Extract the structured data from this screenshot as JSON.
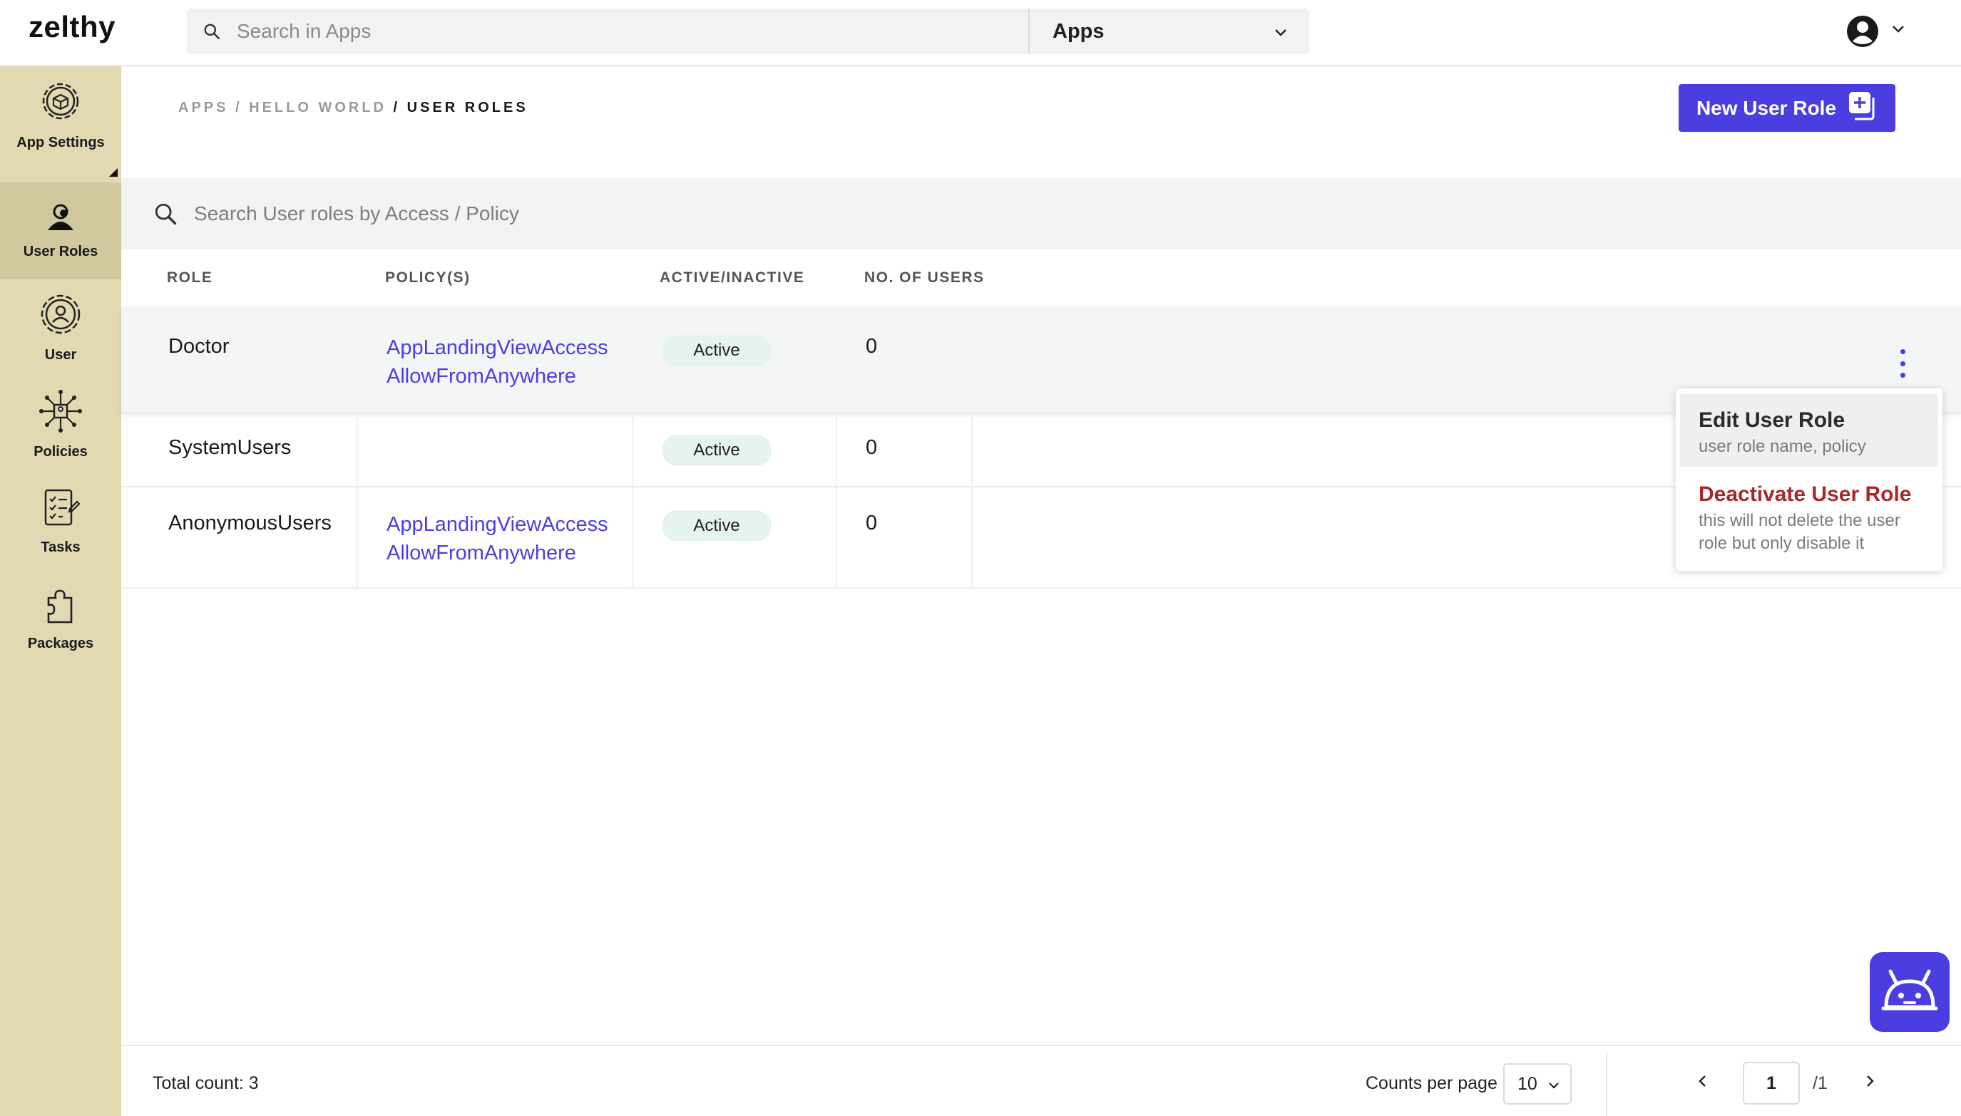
{
  "app": {
    "logo": "zelthy"
  },
  "topbar": {
    "search_placeholder": "Search in Apps",
    "scope_select": "Apps"
  },
  "sidebar": {
    "items": [
      {
        "label": "App Settings",
        "icon": "gear-box-icon"
      },
      {
        "label": "User Roles",
        "icon": "user-role-icon",
        "active": true
      },
      {
        "label": "User",
        "icon": "user-gear-icon"
      },
      {
        "label": "Policies",
        "icon": "policy-network-icon"
      },
      {
        "label": "Tasks",
        "icon": "task-list-icon"
      },
      {
        "label": "Packages",
        "icon": "puzzle-icon"
      }
    ]
  },
  "breadcrumb": {
    "part1": "APPS / HELLO WORLD",
    "current": " / USER ROLES"
  },
  "actions": {
    "new_role": "New User Role"
  },
  "table": {
    "search_placeholder": "Search User roles by Access / Policy",
    "headers": {
      "role": "ROLE",
      "policies": "POLICY(S)",
      "status": "ACTIVE/INACTIVE",
      "users": "NO. OF USERS"
    },
    "rows": [
      {
        "role": "Doctor",
        "policies": [
          "AppLandingViewAccess",
          "AllowFromAnywhere"
        ],
        "status": "Active",
        "users": "0"
      },
      {
        "role": "SystemUsers",
        "policies": [],
        "status": "Active",
        "users": "0"
      },
      {
        "role": "AnonymousUsers",
        "policies": [
          "AppLandingViewAccess",
          "AllowFromAnywhere"
        ],
        "status": "Active",
        "users": "0"
      }
    ]
  },
  "row_menu": {
    "edit_title": "Edit User Role",
    "edit_desc": "user role name, policy",
    "deactivate_title": "Deactivate User Role",
    "deactivate_desc": "this will not delete the user role but only disable it"
  },
  "footer": {
    "total": "Total count: 3",
    "counts_label": "Counts per page",
    "counts_value": "10",
    "page": "1",
    "page_total": "/1"
  },
  "colors": {
    "accent": "#4a3ee0",
    "sidebar": "#e2d9b3",
    "danger": "#a8292c",
    "badge": "#e6f4ef"
  }
}
